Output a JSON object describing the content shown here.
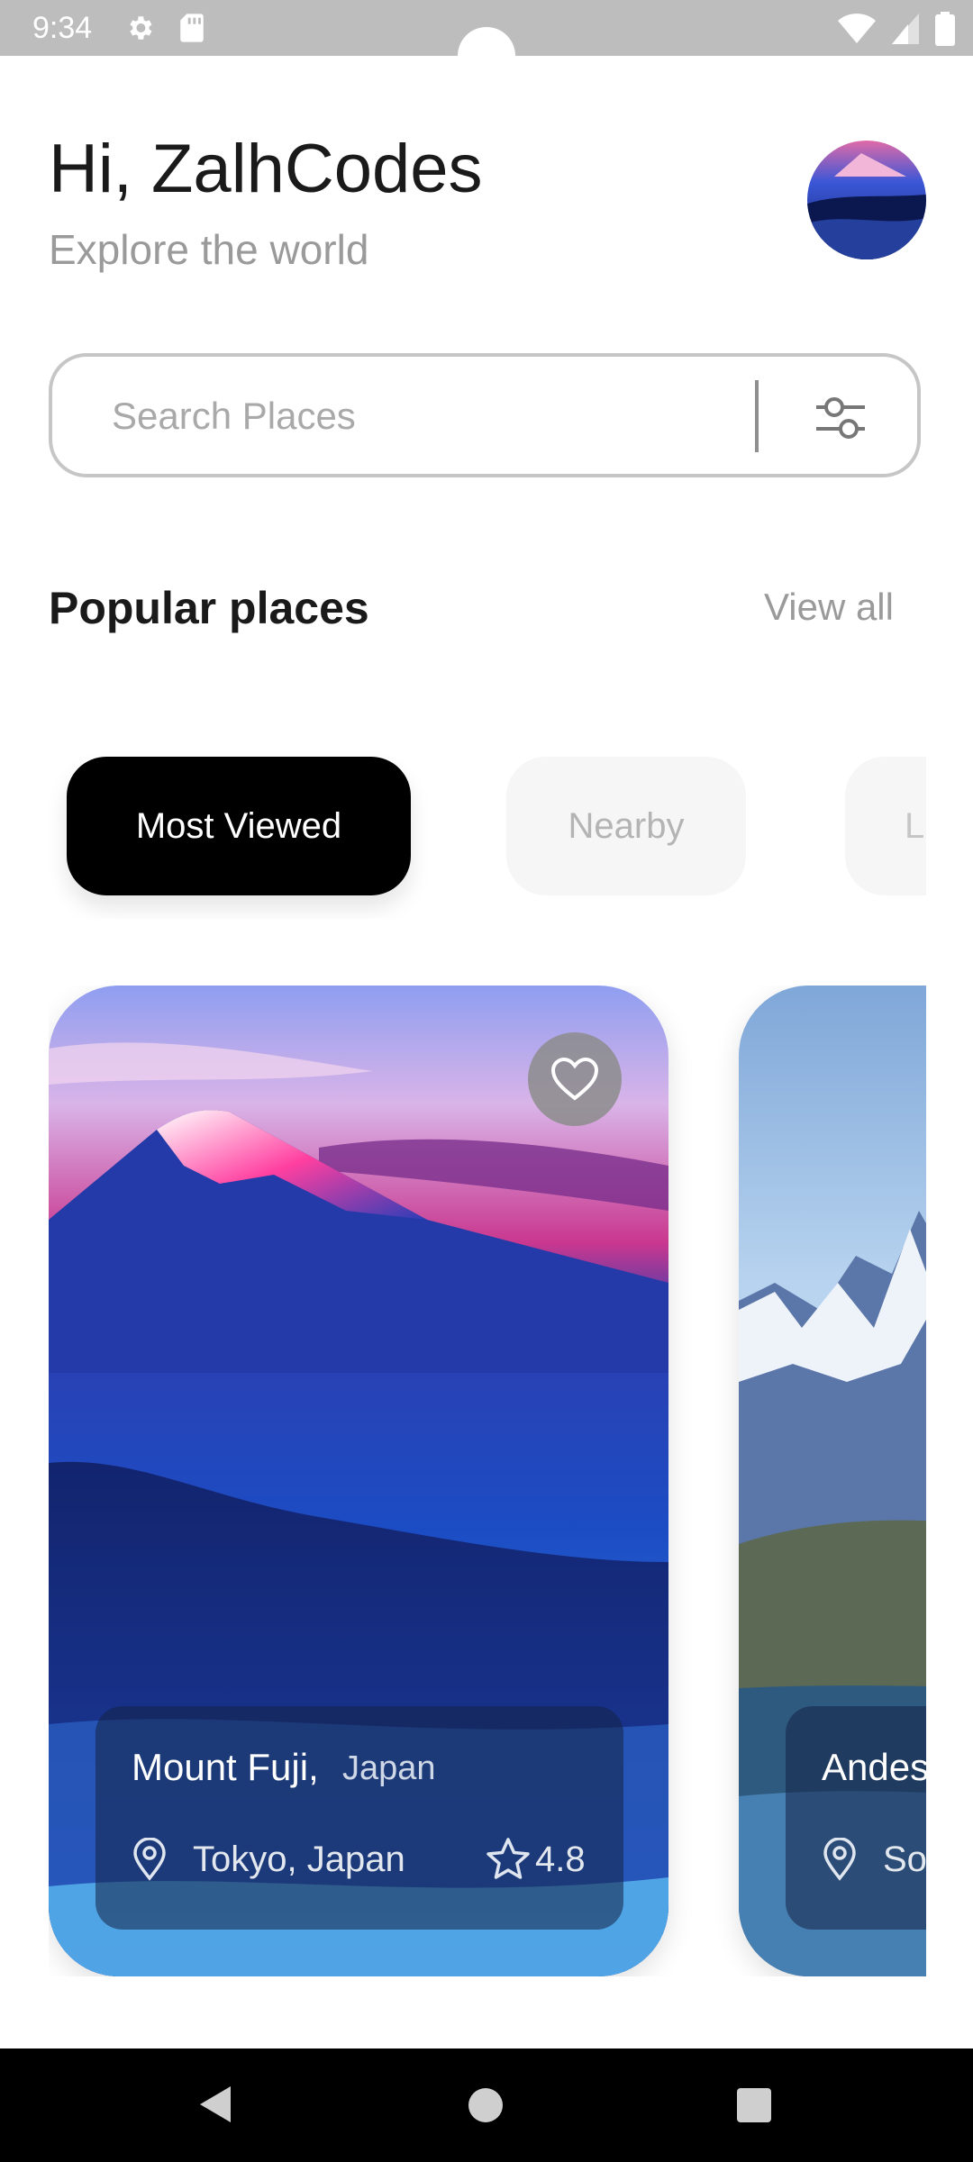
{
  "status_bar": {
    "time": "9:34",
    "icons": [
      "gear-icon",
      "sd-card-icon",
      "wifi-icon",
      "signal-icon",
      "battery-icon"
    ]
  },
  "header": {
    "greeting": "Hi, ZalhCodes",
    "subtitle": "Explore the world"
  },
  "search": {
    "placeholder": "Search Places",
    "value": ""
  },
  "section": {
    "title": "Popular places",
    "view_all": "View all"
  },
  "chips": [
    {
      "label": "Most Viewed",
      "selected": true
    },
    {
      "label": "Nearby",
      "selected": false
    },
    {
      "label": "L",
      "selected": false
    }
  ],
  "cards": [
    {
      "name": "Mount Fuji,",
      "country": "Japan",
      "location": "Tokyo, Japan",
      "rating": "4.8"
    },
    {
      "name": "Andes",
      "country": "",
      "location": "So",
      "rating": ""
    }
  ],
  "colors": {
    "accent": "#000000",
    "muted_text": "#9a9a9a",
    "status_bar": "#bdbdbd"
  }
}
